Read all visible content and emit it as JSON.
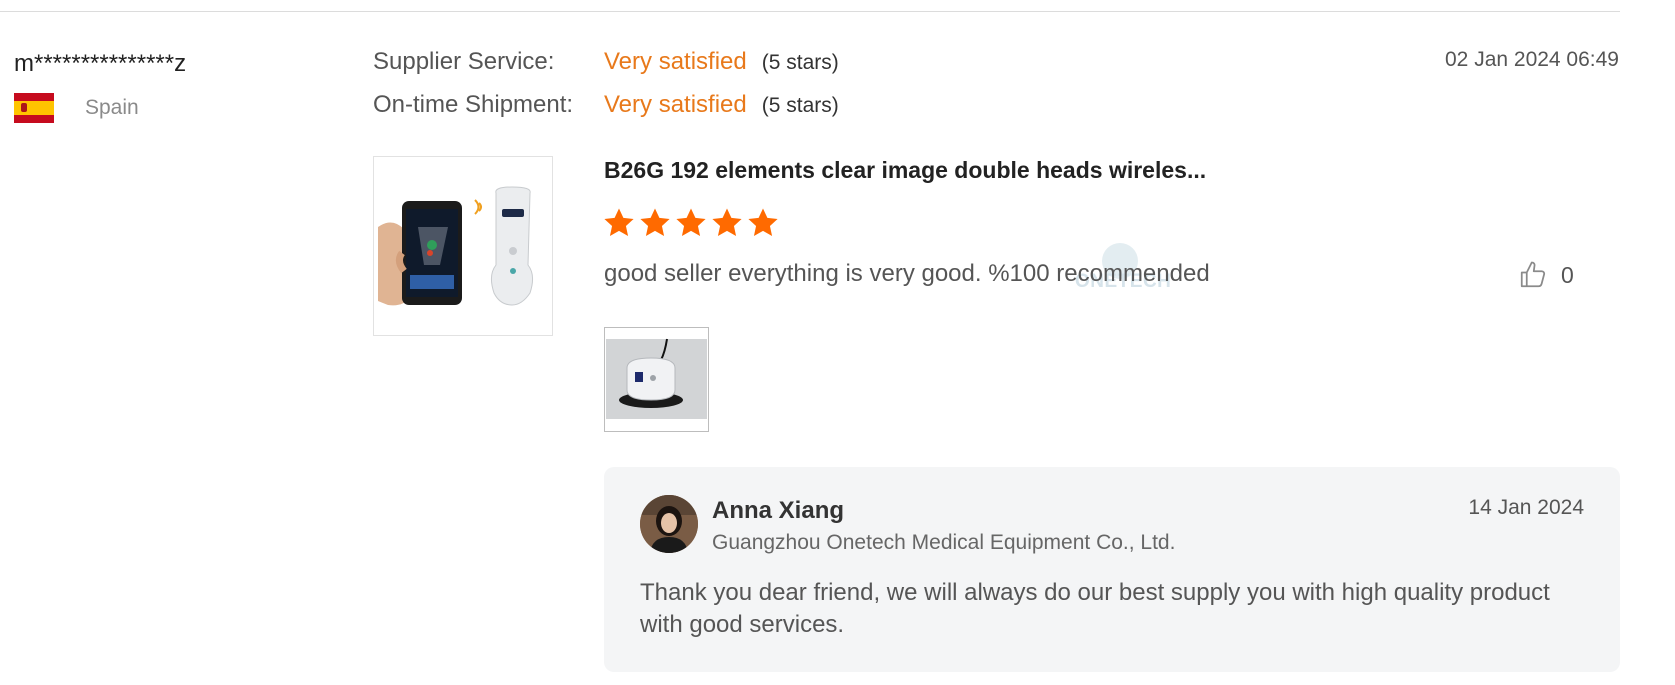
{
  "reviewer": {
    "username": "m***************z",
    "country": "Spain",
    "flag_icon": "spain-flag-icon"
  },
  "ratings": [
    {
      "label": "Supplier Service:",
      "value": "Very satisfied",
      "stars_text": "(5 stars)"
    },
    {
      "label": "On-time Shipment:",
      "value": "Very satisfied",
      "stars_text": "(5 stars)"
    }
  ],
  "review": {
    "date": "02 Jan 2024 06:49",
    "product_title": "B26G 192 elements clear image double heads wireles...",
    "star_rating": 5,
    "star_max": 5,
    "text": "good seller everything is very good. %100 recommended",
    "likes": "0",
    "like_icon": "thumbs-up-icon"
  },
  "watermark": {
    "text": "ONETECH"
  },
  "reply": {
    "name": "Anna Xiang",
    "company": "Guangzhou Onetech Medical Equipment Co., Ltd.",
    "date": "14 Jan 2024",
    "text": "Thank you dear friend, we will always do our best supply you with high quality product with good services."
  },
  "colors": {
    "accent_orange": "#e8791b",
    "star_orange": "#ff6a00",
    "reply_bg": "#f4f5f6"
  }
}
